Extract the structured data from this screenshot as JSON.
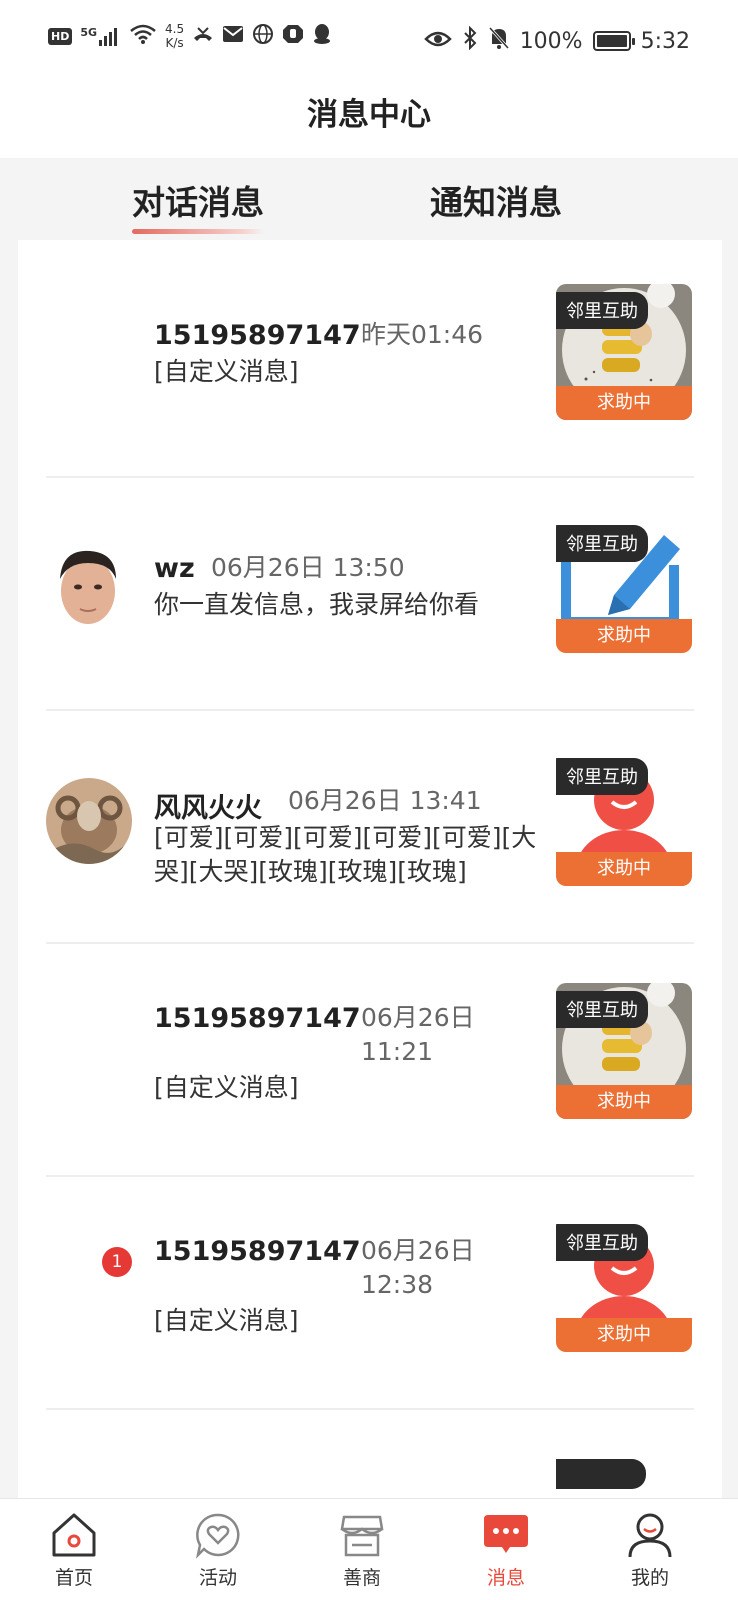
{
  "status_bar": {
    "hd": "HD",
    "network": "5G",
    "speed_value": "4.5",
    "speed_unit": "K/s",
    "battery": "100%",
    "time": "5:32",
    "battery_level": 1.0
  },
  "header": {
    "title": "消息中心"
  },
  "tabs": [
    {
      "label": "对话消息",
      "active": true
    },
    {
      "label": "通知消息",
      "active": false
    }
  ],
  "conversations": [
    {
      "name": "15195897147",
      "time": "昨天01:46",
      "message": "[自定义消息]",
      "tag": "邻里互助",
      "status": "求助中",
      "thumb": "food-plate",
      "avatar": "none",
      "unread": ""
    },
    {
      "name": "wz",
      "time": "06月26日 13:50",
      "message": "你一直发信息，我录屏给你看",
      "tag": "邻里互助",
      "status": "求助中",
      "thumb": "edit-icon",
      "avatar": "man-portrait",
      "unread": ""
    },
    {
      "name": "风风火火",
      "time": "06月26日 13:41",
      "message": "[可爱][可爱][可爱][可爱][可爱][大哭][大哭][玫瑰][玫瑰][玫瑰]",
      "tag": "邻里互助",
      "status": "求助中",
      "thumb": "default-user",
      "avatar": "ram-painting",
      "unread": ""
    },
    {
      "name": "15195897147",
      "time": "06月26日 11:21",
      "message": "[自定义消息]",
      "tag": "邻里互助",
      "status": "求助中",
      "thumb": "food-plate",
      "avatar": "none",
      "unread": ""
    },
    {
      "name": "15195897147",
      "time": "06月26日 12:38",
      "message": "[自定义消息]",
      "tag": "邻里互助",
      "status": "求助中",
      "thumb": "default-user",
      "avatar": "none",
      "unread": "1"
    }
  ],
  "nav": [
    {
      "label": "首页",
      "icon": "home-icon"
    },
    {
      "label": "活动",
      "icon": "heart-bubble-icon"
    },
    {
      "label": "善商",
      "icon": "shop-icon"
    },
    {
      "label": "消息",
      "icon": "message-icon",
      "active": true
    },
    {
      "label": "我的",
      "icon": "profile-icon"
    }
  ],
  "colors": {
    "accent": "#ec6f34",
    "active_nav": "#e8493b",
    "badge": "#e53935"
  }
}
